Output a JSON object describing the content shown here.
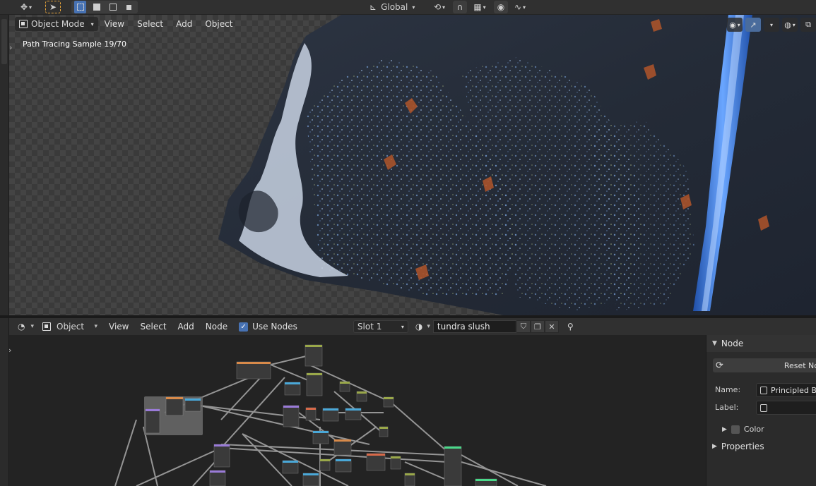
{
  "toolbar": {
    "transform_orientation": "Global"
  },
  "viewport": {
    "header": {
      "mode": "Object Mode",
      "menus": [
        "View",
        "Select",
        "Add",
        "Object"
      ]
    },
    "overlay_text": "Path Tracing Sample 19/70"
  },
  "node_editor": {
    "header": {
      "object_type": "Object",
      "menus": [
        "View",
        "Select",
        "Add",
        "Node"
      ],
      "use_nodes_label": "Use Nodes",
      "use_nodes_checked": true,
      "slot": "Slot 1",
      "material_name": "tundra slush"
    }
  },
  "side_panel": {
    "node_section_title": "Node",
    "reset_button": "Reset No",
    "name_label": "Name:",
    "name_value": "Principled BS",
    "label_label": "Label:",
    "label_value": "",
    "color_label": "Color",
    "properties_label": "Properties"
  },
  "colors": {
    "accent": "#4772b3",
    "waterfall": "#3f7dd8",
    "header_bg": "#303030"
  }
}
